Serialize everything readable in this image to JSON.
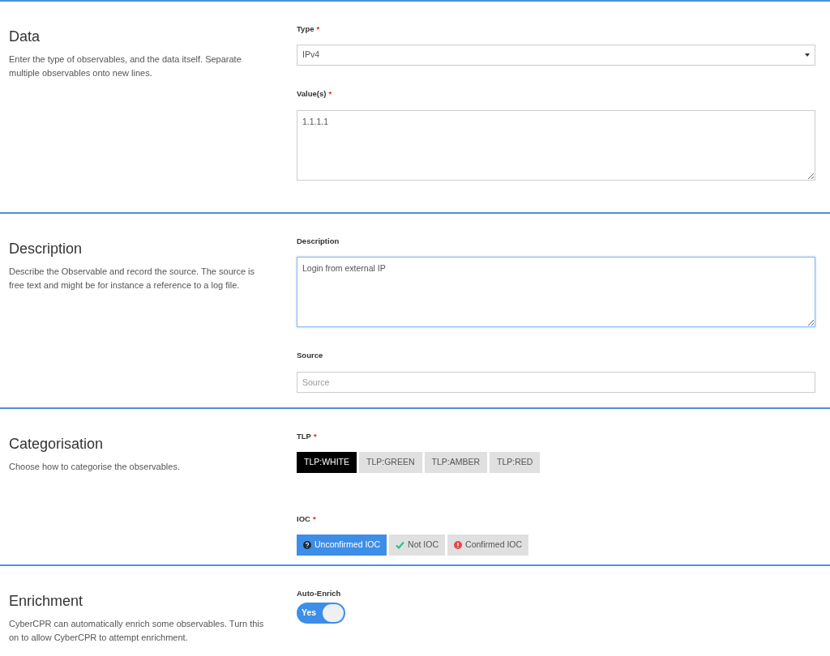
{
  "sections": [
    {
      "title": "Data",
      "description": "Enter the type of observables, and the data itself. Separate multiple observables onto new lines.",
      "fields": [
        {
          "kind": "select",
          "label": "Type",
          "required_mark": "*",
          "value": "IPv4"
        },
        {
          "kind": "textarea",
          "label": "Value(s)",
          "required_mark": "*",
          "value": "1.1.1.1",
          "focused": false
        }
      ]
    },
    {
      "title": "Description",
      "description": "Describe the Observable and record the source. The source is free text and might be for instance a reference to a log file.",
      "fields": [
        {
          "kind": "textarea",
          "label": "Description",
          "value": "Login from external IP",
          "focused": true
        },
        {
          "kind": "input",
          "label": "Source",
          "placeholder": "Source"
        }
      ]
    },
    {
      "title": "Categorisation",
      "description": "Choose how to categorise the observables.",
      "fields": [
        {
          "kind": "tlp",
          "label": "TLP",
          "required_mark": "*",
          "options": [
            {
              "label": "TLP:WHITE",
              "selected": true
            },
            {
              "label": "TLP:GREEN",
              "selected": false
            },
            {
              "label": "TLP:AMBER",
              "selected": false
            },
            {
              "label": "TLP:RED",
              "selected": false
            }
          ]
        },
        {
          "kind": "ioc",
          "label": "IOC",
          "required_mark": "*",
          "options": [
            {
              "label": "Unconfirmed IOC",
              "kind": "unconfirmed",
              "selected": true
            },
            {
              "label": "Not IOC",
              "kind": "not",
              "selected": false
            },
            {
              "label": "Confirmed IOC",
              "kind": "confirmed",
              "selected": false
            }
          ]
        }
      ]
    },
    {
      "title": "Enrichment",
      "description": "CyberCPR can automatically enrich some observables. Turn this on to allow CyberCPR to attempt enrichment.",
      "fields": [
        {
          "kind": "toggle",
          "label": "Auto-Enrich",
          "on": true,
          "text": "Yes"
        }
      ]
    }
  ]
}
